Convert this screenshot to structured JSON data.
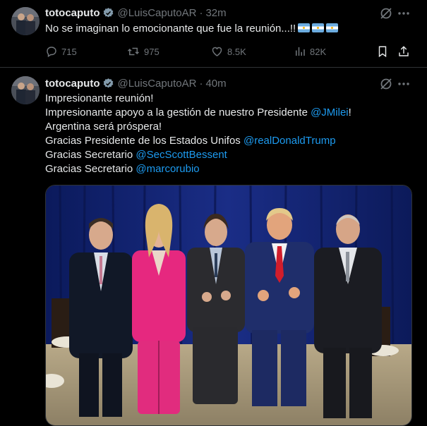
{
  "tweets": [
    {
      "display_name": "totocaputo",
      "handle": "@LuisCaputoAR",
      "separator": "·",
      "time": "32m",
      "text": "No se imaginan lo emocionante que fue la reunión...!!",
      "replies": "715",
      "reposts": "975",
      "likes": "8.5K",
      "views": "82K"
    },
    {
      "display_name": "totocaputo",
      "handle": "@LuisCaputoAR",
      "separator": "·",
      "time": "40m",
      "lines": [
        {
          "text": "Impresionante reunión!",
          "mention": "",
          "suffix": ""
        },
        {
          "text": "Impresionante apoyo a la gestión de nuestro Presidente ",
          "mention": "@JMilei",
          "suffix": "!"
        },
        {
          "text": "Argentina será próspera!",
          "mention": "",
          "suffix": ""
        },
        {
          "text": "Gracias Presidente de los Estados Unifos ",
          "mention": "@realDonaldTrump",
          "suffix": ""
        },
        {
          "text": "Gracias Secretario ",
          "mention": "@SecScottBessent",
          "suffix": ""
        },
        {
          "text": "Gracias Secretario ",
          "mention": "@marcorubio",
          "suffix": ""
        }
      ]
    }
  ],
  "colors": {
    "background": "#000000",
    "text": "#e7e9ea",
    "secondary": "#71767b",
    "link": "#1d9bf0",
    "verified": "#829aab",
    "divider": "#2f3336"
  },
  "icons": {
    "verified": "verified-badge-icon",
    "grok": "grok-icon",
    "more": "more-icon",
    "reply": "reply-icon",
    "repost": "repost-icon",
    "like": "like-icon",
    "views": "views-icon",
    "bookmark": "bookmark-icon",
    "share": "share-icon",
    "flag": "argentina-flag-icon"
  }
}
